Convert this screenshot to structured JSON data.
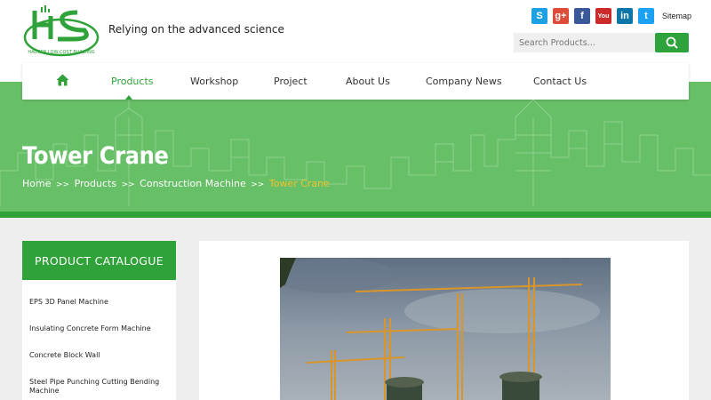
{
  "brand": {
    "logo_letters": "HS",
    "logo_text": "HAOSEN LOW-COST BUILDING",
    "tagline": "Relying on the advanced science"
  },
  "social": [
    {
      "name": "skype-icon",
      "glyph": "S",
      "color": "#1da1e2"
    },
    {
      "name": "google-plus-icon",
      "glyph": "g+",
      "color": "#dd4b39"
    },
    {
      "name": "facebook-icon",
      "glyph": "f",
      "color": "#3b5998"
    },
    {
      "name": "youtube-icon",
      "glyph": "You",
      "color": "#cc2b2b"
    },
    {
      "name": "linkedin-icon",
      "glyph": "in",
      "color": "#0e76a8"
    },
    {
      "name": "twitter-icon",
      "glyph": "t",
      "color": "#1da1f2"
    }
  ],
  "sitemap_label": "Sitemap",
  "search": {
    "placeholder": "Search Products..."
  },
  "nav": {
    "items": [
      "Products",
      "Workshop",
      "Project",
      "About Us",
      "Company News",
      "Contact Us"
    ],
    "active": "Products"
  },
  "hero": {
    "title": "Tower Crane",
    "breadcrumb": [
      "Home",
      "Products",
      "Construction Machine",
      "Tower Crane"
    ],
    "separator": ">>"
  },
  "sidebar": {
    "heading": "PRODUCT CATALOGUE",
    "items": [
      "EPS 3D Panel Machine",
      "Insulating Concrete Form Machine",
      "Concrete Block Wall",
      "Steel Pipe Punching Cutting Bending Machine"
    ]
  },
  "colors": {
    "brand_green": "#2fa23a",
    "hero_green": "#67bf67",
    "breadcrumb_current": "#f0c22d"
  }
}
